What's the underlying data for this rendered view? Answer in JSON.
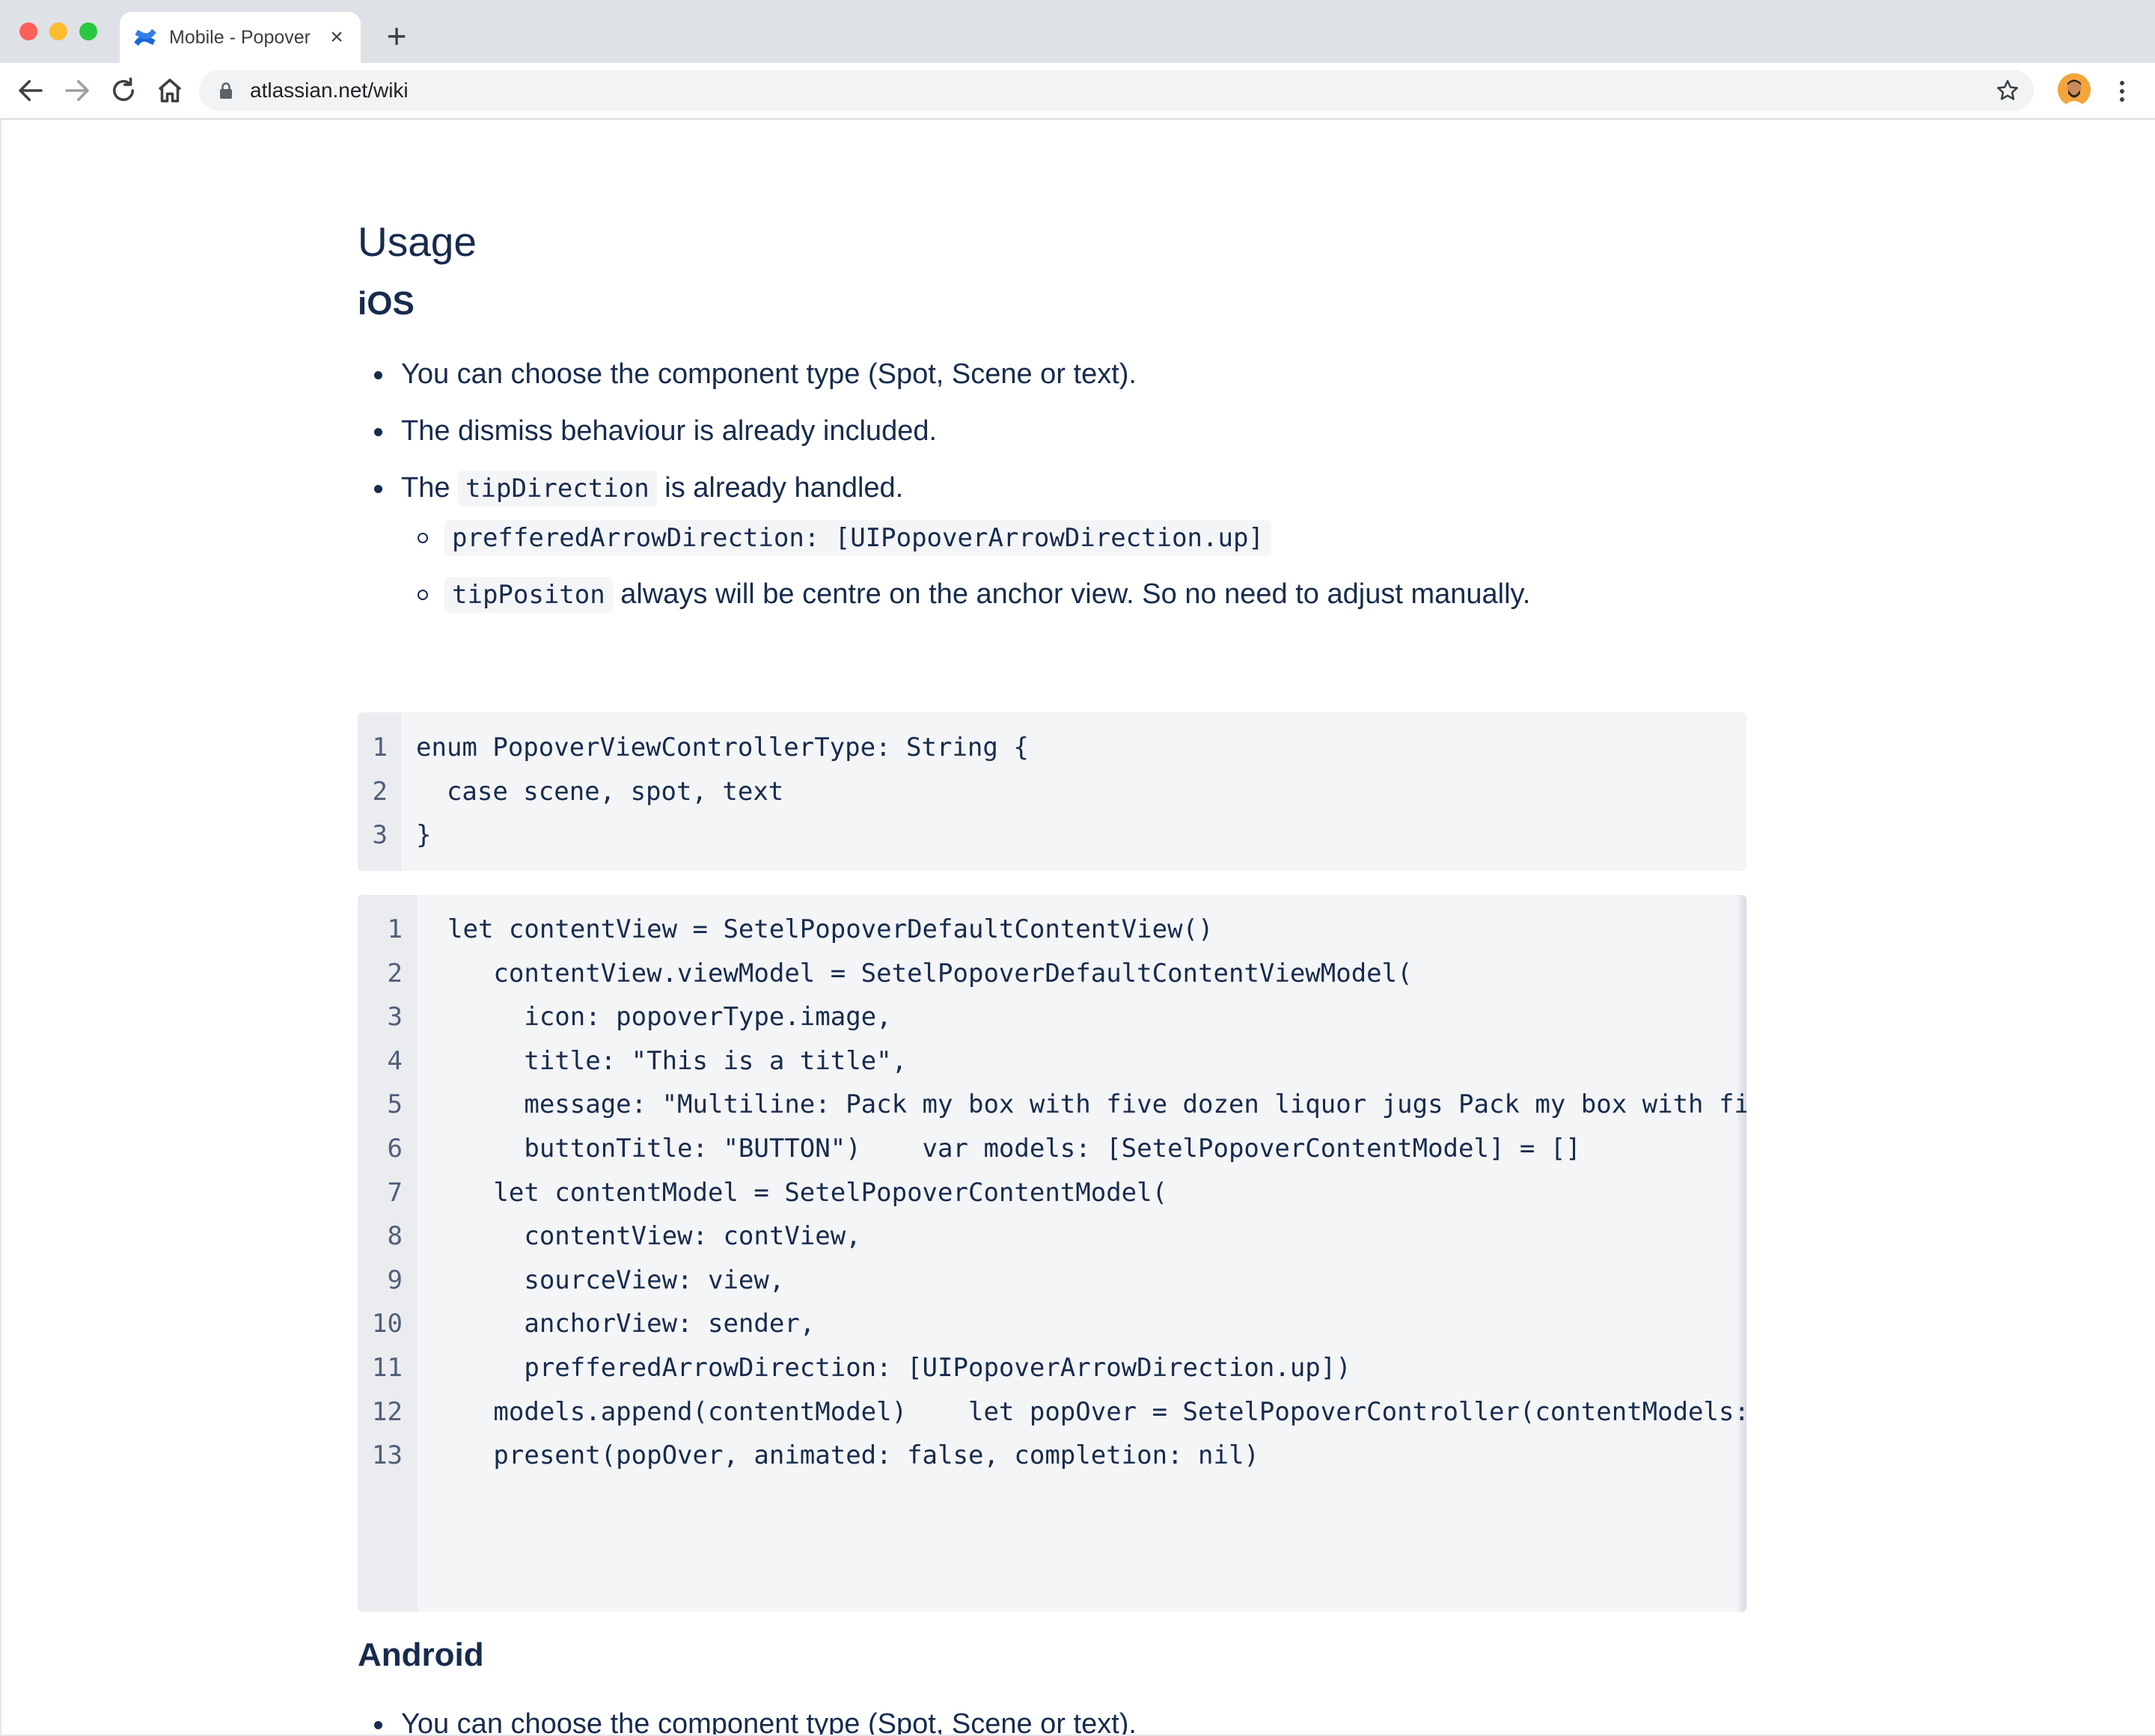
{
  "browser": {
    "tab_title": "Mobile - Popover",
    "tab_close": "×",
    "new_tab": "+",
    "url": "atlassian.net/wiki"
  },
  "doc": {
    "usage_heading": "Usage",
    "ios_heading": "iOS",
    "ios_bullets": {
      "b1": "You can choose the component type (Spot, Scene or text).",
      "b2": "The dismiss behaviour is already included.",
      "b3_prefix": "The",
      "b3_code": "tipDirection",
      "b3_suffix": "is already handled.",
      "sub1_code": "prefferedArrowDirection: [UIPopoverArrowDirection.up]",
      "sub2_code": "tipPositon",
      "sub2_text": "always will be centre on the anchor view. So no need to adjust manually."
    },
    "code_block_1": [
      {
        "n": "1",
        "text": "enum PopoverViewControllerType: String {"
      },
      {
        "n": "2",
        "text": "  case scene, spot, text"
      },
      {
        "n": "3",
        "text": "}"
      }
    ],
    "code_block_2": [
      {
        "n": "1",
        "text": "let contentView = SetelPopoverDefaultContentView()"
      },
      {
        "n": "2",
        "text": "   contentView.viewModel = SetelPopoverDefaultContentViewModel("
      },
      {
        "n": "3",
        "text": "     icon: popoverType.image,"
      },
      {
        "n": "4",
        "text": "     title: \"This is a title\","
      },
      {
        "n": "5",
        "text": "     message: \"Multiline: Pack my box with five dozen liquor jugs Pack my box with five dozen liquor jugs\","
      },
      {
        "n": "6",
        "text": "     buttonTitle: \"BUTTON\")    var models: [SetelPopoverContentModel] = []"
      },
      {
        "n": "7",
        "text": "   let contentModel = SetelPopoverContentModel("
      },
      {
        "n": "8",
        "text": "     contentView: contView,"
      },
      {
        "n": "9",
        "text": "     sourceView: view,"
      },
      {
        "n": "10",
        "text": "     anchorView: sender,"
      },
      {
        "n": "11",
        "text": "     prefferedArrowDirection: [UIPopoverArrowDirection.up])"
      },
      {
        "n": "12",
        "text": "   models.append(contentModel)    let popOver = SetelPopoverController(contentModels: models)"
      },
      {
        "n": "13",
        "text": "   present(popOver, animated: false, completion: nil)"
      }
    ],
    "android_heading": "Android",
    "android_bullets": {
      "b1": "You can choose the component type (Spot, Scene or text)."
    }
  },
  "colors": {
    "text": "#172b4d",
    "code_bg": "#f4f5f7",
    "gutter_bg": "#ebecf0",
    "confluence_blue": "#1868db"
  },
  "icons": [
    "confluence-logo-icon",
    "back-arrow-icon",
    "forward-arrow-icon",
    "reload-icon",
    "home-icon",
    "lock-icon",
    "bookmark-star-icon",
    "profile-avatar",
    "more-menu-icon"
  ]
}
